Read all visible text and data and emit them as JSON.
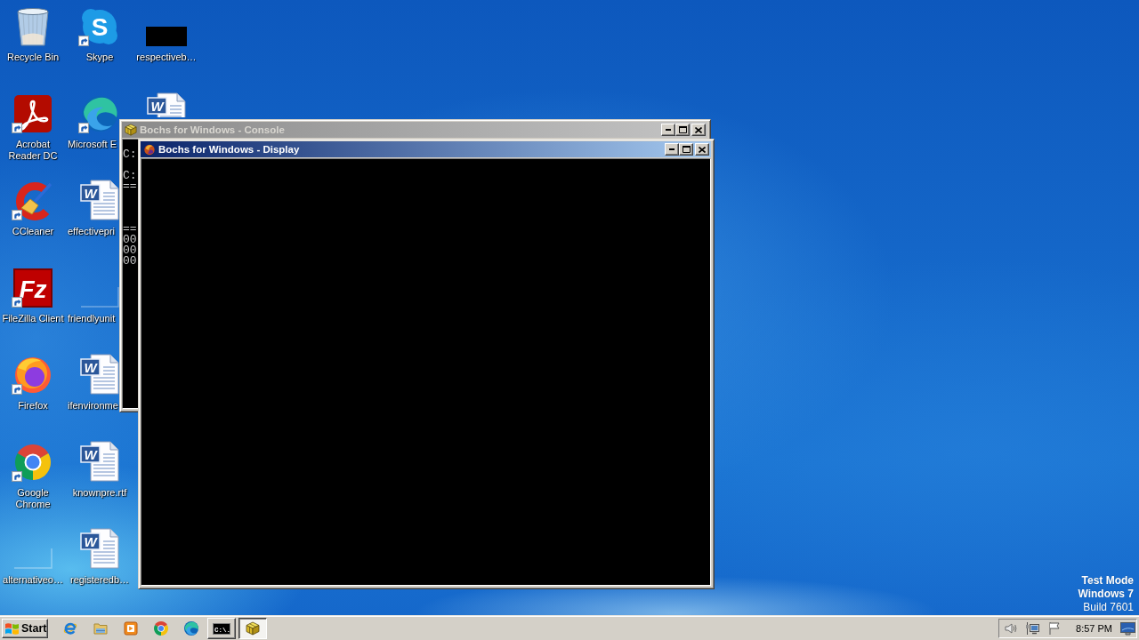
{
  "desktop_icons": [
    {
      "label": "Recycle Bin",
      "shortcut": false
    },
    {
      "label": "Acrobat Reader DC",
      "shortcut": true
    },
    {
      "label": "CCleaner",
      "shortcut": true
    },
    {
      "label": "FileZilla Client",
      "icon_letter": "Fz",
      "shortcut": true
    },
    {
      "label": "Firefox",
      "shortcut": true
    },
    {
      "label": "Google Chrome",
      "shortcut": true
    },
    {
      "label": "alternativeo…",
      "shortcut": false
    },
    {
      "label": "Skype",
      "icon_letter": "S",
      "shortcut": true
    },
    {
      "label": "Microsoft E",
      "shortcut": true
    },
    {
      "label": "effectivepri",
      "icon_letter": "W",
      "shortcut": false
    },
    {
      "label": "friendlyunit",
      "shortcut": false
    },
    {
      "label": "ifenvironme",
      "icon_letter": "W",
      "shortcut": false
    },
    {
      "label": "knownpre.rtf",
      "icon_letter": "W",
      "shortcut": false
    },
    {
      "label": "registeredb…",
      "icon_letter": "W",
      "shortcut": false
    },
    {
      "label": "respectiveb…",
      "shortcut": false
    },
    {
      "icon_letter": "W",
      "shortcut": false
    }
  ],
  "console_window": {
    "title": "Bochs for Windows - Console",
    "active": false,
    "output": "C:\n\nC:\n==\n\n\n\n==\n00\n00\n00"
  },
  "display_window": {
    "title": "Bochs for Windows - Display",
    "active": true
  },
  "os_watermark": {
    "mode": "Test Mode",
    "edition": "Windows 7",
    "build": "Build 7601"
  },
  "taskbar": {
    "start": "Start",
    "tasks": [
      {
        "icon_text": "C:\\.",
        "selected": false
      },
      {
        "selected": true
      }
    ],
    "clock": "8:57 PM"
  }
}
